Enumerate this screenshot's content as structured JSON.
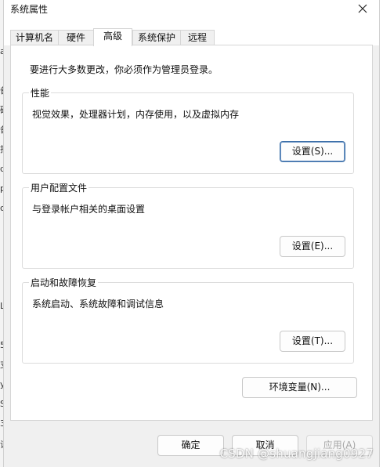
{
  "window": {
    "title": "系统属性",
    "close_icon": "close-icon"
  },
  "tabs": [
    {
      "label": "计算机名",
      "active": false
    },
    {
      "label": "硬件",
      "active": false
    },
    {
      "label": "高级",
      "active": true
    },
    {
      "label": "系统保护",
      "active": false
    },
    {
      "label": "远程",
      "active": false
    }
  ],
  "panel": {
    "notice": "要进行大多数更改，你必须作为管理员登录。",
    "groups": [
      {
        "title": "性能",
        "description": "视觉效果，处理器计划，内存使用，以及虚拟内存",
        "button": "设置(S)..."
      },
      {
        "title": "用户配置文件",
        "description": "与登录帐户相关的桌面设置",
        "button": "设置(E)..."
      },
      {
        "title": "启动和故障恢复",
        "description": "系统启动、系统故障和调试信息",
        "button": "设置(T)..."
      }
    ],
    "env_button": "环境变量(N)..."
  },
  "footer": {
    "ok": "确定",
    "cancel": "取消",
    "apply": "应用(A)"
  },
  "background_glyphs": [
    "a",
    "备",
    "码",
    "备",
    "拒",
    "d",
    "p",
    "c",
    "L",
    "5",
    "支",
    "y",
    "S",
    "3",
    "设"
  ],
  "watermark": "CSDN @shuangjiang0927"
}
